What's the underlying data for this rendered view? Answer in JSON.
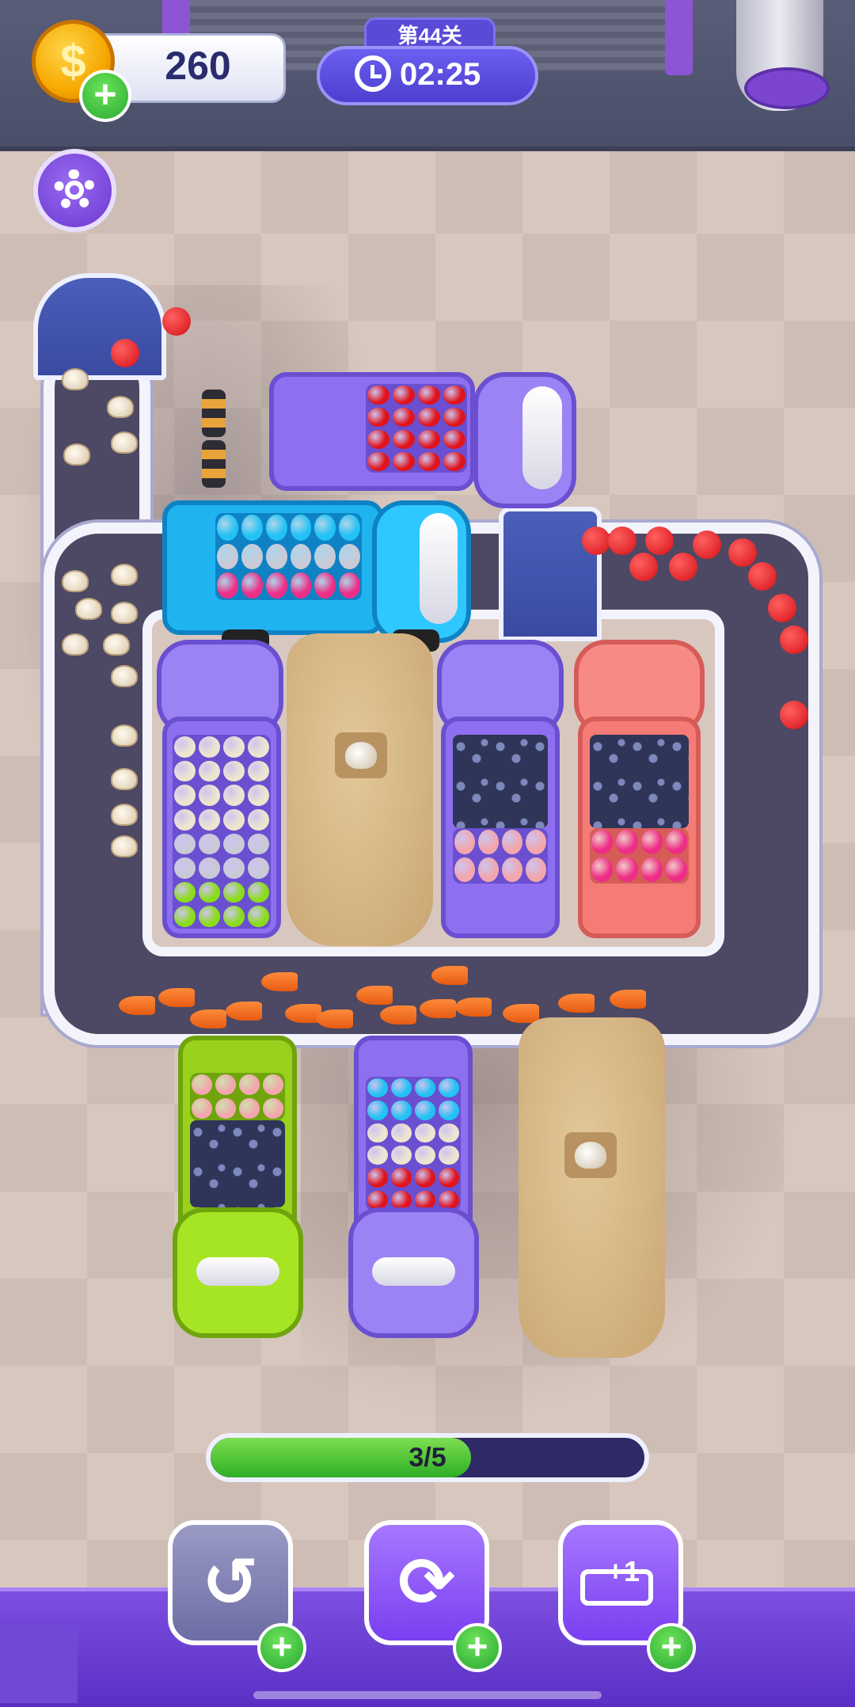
{
  "hud": {
    "coins": "260",
    "coin_symbol": "$",
    "level": "第44关",
    "timer": "02:25"
  },
  "progress": {
    "label": "3/5",
    "fraction": 0.6
  },
  "tools": {
    "undo_icon": "undo-icon",
    "shuffle_icon": "shuffle-icon",
    "add_truck_label": "+1",
    "plus": "+"
  },
  "colors": {
    "accent_purple": "#7a3ff0",
    "progress_green": "#2eae25",
    "coin_gold": "#f6a800"
  },
  "trucks": [
    {
      "id": "purple-top",
      "color": "purple",
      "cargo": [
        "tomato"
      ]
    },
    {
      "id": "blue",
      "color": "cyan",
      "cargo": [
        "blue-egg",
        "silver",
        "pink-ball"
      ]
    },
    {
      "id": "purple-left",
      "color": "purple",
      "cargo": [
        "mushroom",
        "silver",
        "green-ball"
      ]
    },
    {
      "id": "tarp-mid",
      "color": "covered",
      "cargo": [
        "mushroom"
      ]
    },
    {
      "id": "purple-right",
      "color": "purple",
      "cargo": [
        "mystery",
        "pig"
      ]
    },
    {
      "id": "red",
      "color": "salmon",
      "cargo": [
        "mystery",
        "pink-ball"
      ]
    },
    {
      "id": "lime-bottom",
      "color": "lime",
      "cargo": [
        "pig",
        "mystery"
      ]
    },
    {
      "id": "purple-bottom",
      "color": "purple",
      "cargo": [
        "blue-egg",
        "mushroom",
        "tomato"
      ]
    },
    {
      "id": "tarp-bottom",
      "color": "covered",
      "cargo": [
        "mushroom"
      ]
    }
  ]
}
